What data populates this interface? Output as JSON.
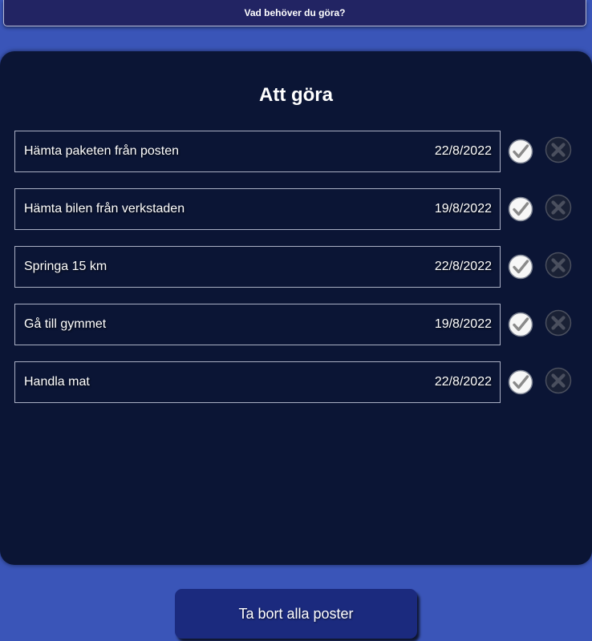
{
  "input": {
    "placeholder": "Vad behöver du göra?"
  },
  "list": {
    "title": "Att göra",
    "items": [
      {
        "text": "Hämta paketen från posten",
        "date": "22/8/2022"
      },
      {
        "text": "Hämta bilen från verkstaden",
        "date": "19/8/2022"
      },
      {
        "text": "Springa 15 km",
        "date": "22/8/2022"
      },
      {
        "text": "Gå till gymmet",
        "date": "19/8/2022"
      },
      {
        "text": "Handla mat",
        "date": "22/8/2022"
      }
    ]
  },
  "actions": {
    "clear_all_label": "Ta bort alla poster"
  },
  "icons": {
    "complete": "check-circle-icon",
    "delete": "close-circle-icon"
  },
  "colors": {
    "page_background": "#3a55b8",
    "panel_background": "#0b1535",
    "input_background": "#222463",
    "button_background": "#1b2a7e"
  }
}
